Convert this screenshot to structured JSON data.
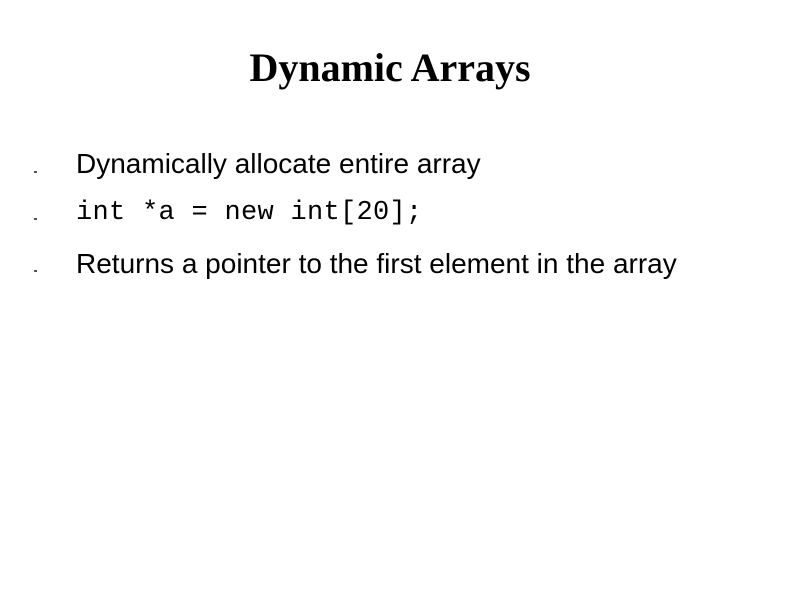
{
  "slide": {
    "title": "Dynamic Arrays",
    "bullets": [
      {
        "text": "Dynamically allocate entire array",
        "style": "normal"
      },
      {
        "text": "int *a = new int[20];",
        "style": "code"
      },
      {
        "text": "Returns a pointer to the first element in the array",
        "style": "normal"
      }
    ]
  }
}
